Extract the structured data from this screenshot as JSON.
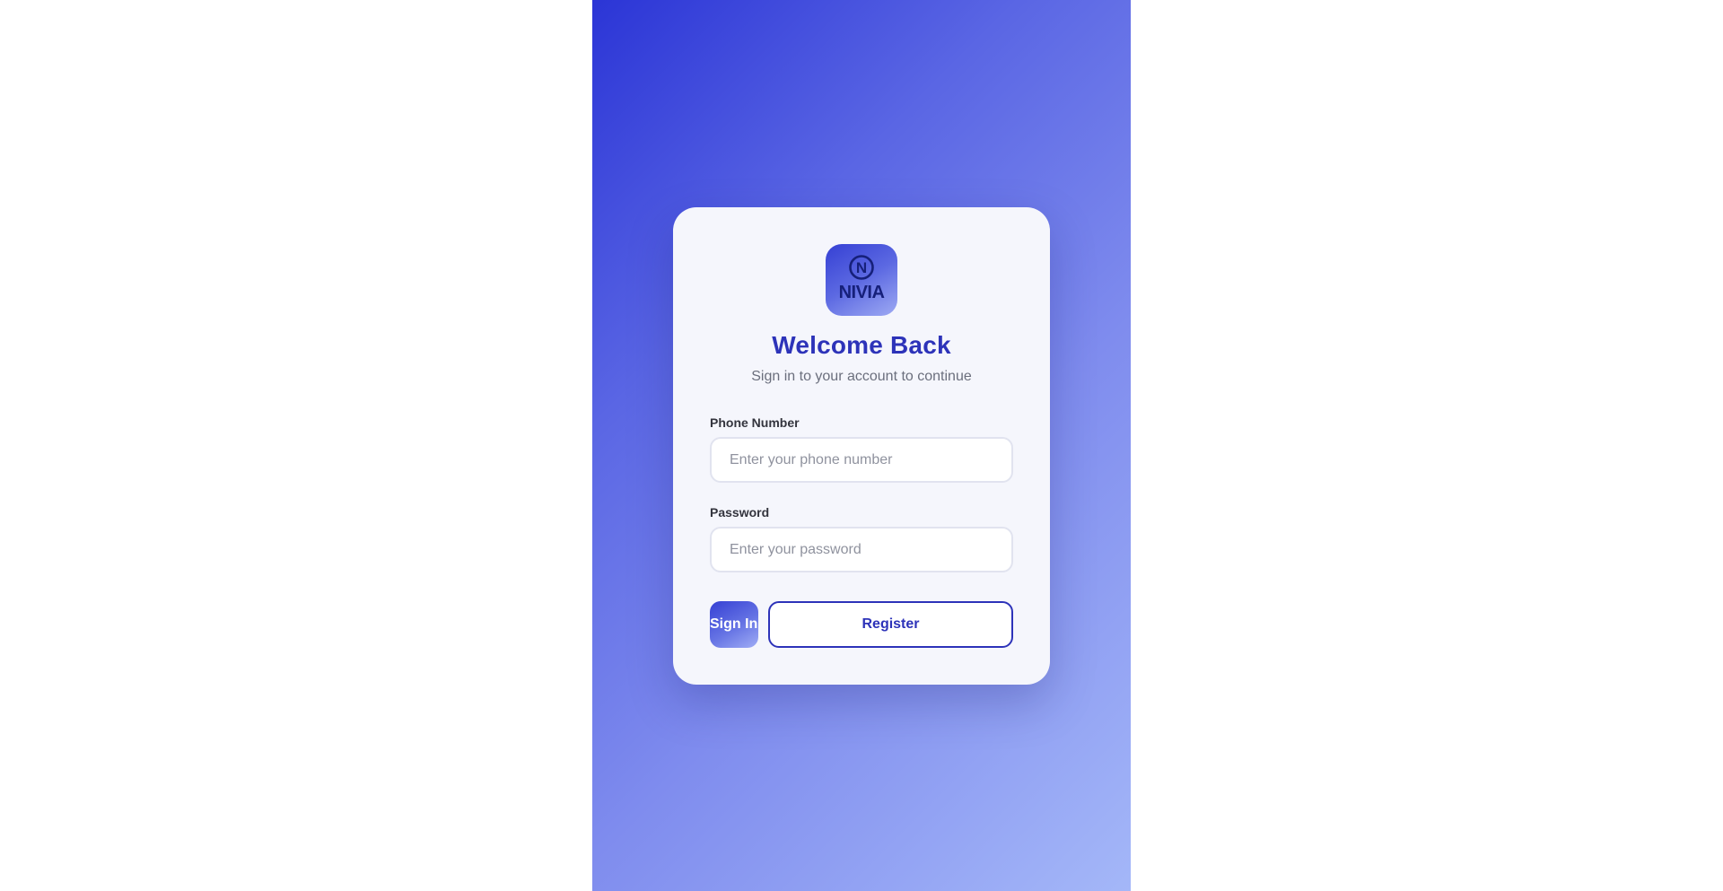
{
  "brand": {
    "logo_text": "NIVIA",
    "logo_monogram": "N",
    "primary_color": "#2d33b9",
    "gradient_start": "#2b35d6",
    "gradient_end": "#a4b7f8"
  },
  "login": {
    "title": "Welcome Back",
    "subtitle": "Sign in to your account to continue",
    "phone": {
      "label": "Phone Number",
      "placeholder": "Enter your phone number",
      "value": ""
    },
    "password": {
      "label": "Password",
      "placeholder": "Enter your password",
      "value": ""
    },
    "signin_label": "Sign In",
    "register_label": "Register"
  }
}
